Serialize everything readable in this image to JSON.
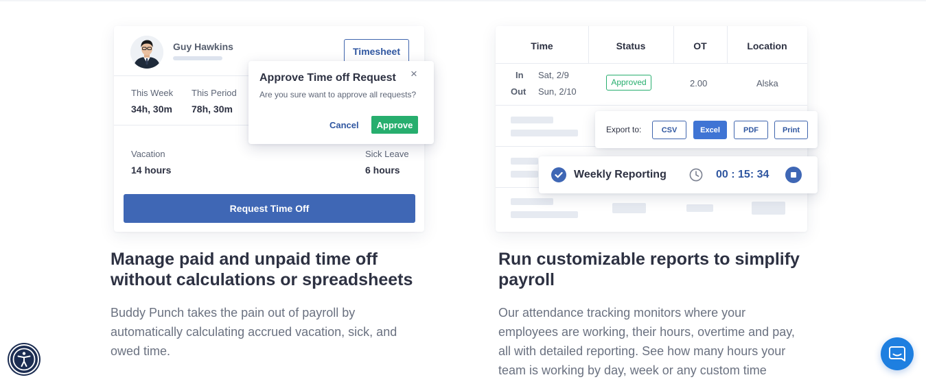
{
  "timesheet_card": {
    "user_name": "Guy Hawkins",
    "timesheet_button": "Timesheet",
    "this_week_label": "This Week",
    "this_week_value": "34h, 30m",
    "this_period_label": "This Period",
    "this_period_value": "78h, 30m",
    "vacation_label": "Vacation",
    "vacation_value": "14 hours",
    "sick_leave_label": "Sick Leave",
    "sick_leave_value": "6 hours",
    "request_button": "Request Time Off"
  },
  "approve_modal": {
    "title": "Approve Time off Request",
    "message": "Are you sure want to approve all requests?",
    "close_icon": "×",
    "cancel_label": "Cancel",
    "approve_label": "Approve"
  },
  "report_card": {
    "headers": [
      "Time",
      "Status",
      "OT",
      "Location"
    ],
    "row": {
      "in_label": "In",
      "in_date": "Sat, 2/9",
      "out_label": "Out",
      "out_date": "Sun, 2/10",
      "status": "Approved",
      "ot": "2.00",
      "location": "Alska"
    },
    "export_label": "Export to:",
    "export_buttons": [
      "CSV",
      "Excel",
      "PDF",
      "Print"
    ],
    "weekly_label": "Weekly Reporting",
    "timer": "00 : 15: 34"
  },
  "section_left": {
    "heading_line1": "Manage paid and unpaid time off",
    "heading_line2": "without calculations or spreadsheets",
    "body_line1": "Buddy Punch takes the pain out of payroll by",
    "body_line2": "automatically calculating accrued vacation, sick, and",
    "body_line3": "owed time."
  },
  "section_right": {
    "heading_line1": "Run customizable reports to simplify",
    "heading_line2": "payroll",
    "body_line1": "Our attendance tracking monitors where your",
    "body_line2": "employees are working, their hours, overtime and pay,",
    "body_line3": "all with detailed reporting. See how many hours your",
    "body_line4": "team is working by day, week or any custom time"
  },
  "colors": {
    "primary": "#3f67b5",
    "approve_green": "#27ae6e",
    "excel_active": "#3f74d4",
    "chat_button": "#1e7fe0",
    "accessibility_button": "#1c2d52"
  },
  "icons": {
    "accessibility": "accessibility-icon",
    "chat": "chat-icon",
    "check": "check-circle-icon",
    "clock": "clock-icon",
    "stop": "stop-icon",
    "close": "close-icon"
  }
}
